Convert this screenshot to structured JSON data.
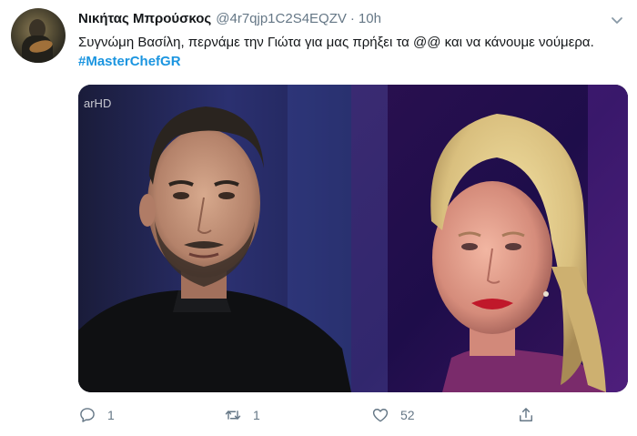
{
  "tweet": {
    "name": "Νικήτας Μπρούσκος",
    "handle": "@4r7qjp1C2S4EQZV",
    "separator": "·",
    "time": "10h",
    "text": "Συγνώμη Βασίλη, περνάμε την Γιώτα για μας πρήξει τα @@ και να κάνουμε νούμερα.",
    "hashtag": "#MasterChefGR",
    "media_watermark": "arHD"
  },
  "actions": {
    "reply_count": "1",
    "retweet_count": "1",
    "like_count": "52"
  },
  "colors": {
    "hashtag": "#1b95e0",
    "secondary_text": "#657786",
    "primary_text": "#14171a"
  },
  "icons": {
    "reply": "comment-icon",
    "retweet": "retweet-icon",
    "like": "heart-icon",
    "share": "share-icon",
    "menu": "chevron-down-icon"
  }
}
